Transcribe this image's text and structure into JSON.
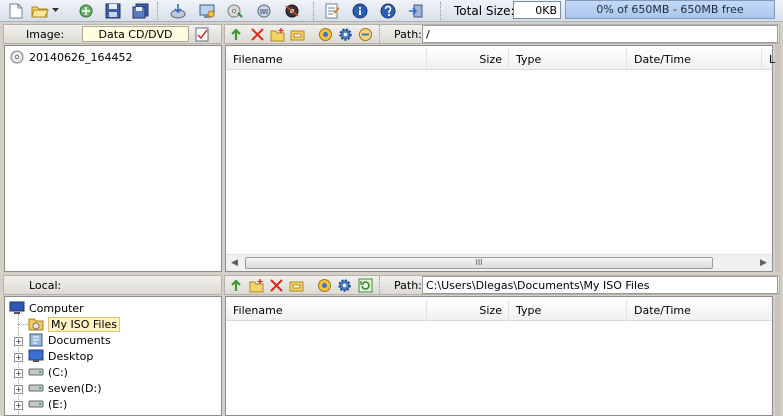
{
  "toolbar": {
    "buttons": [
      {
        "name": "new-icon"
      },
      {
        "name": "open-icon"
      },
      {
        "name": "open-dropdown-icon"
      },
      {
        "name": "recycle-icon"
      },
      {
        "name": "save-icon"
      },
      {
        "name": "save-as-icon"
      },
      {
        "name": "extract-icon"
      },
      {
        "name": "burn-icon"
      },
      {
        "name": "mount-icon"
      },
      {
        "name": "compress-icon"
      },
      {
        "name": "virtual-drive-icon"
      },
      {
        "name": "properties-icon"
      },
      {
        "name": "info-icon"
      },
      {
        "name": "help-icon"
      },
      {
        "name": "exit-icon"
      }
    ],
    "total_size_label": "Total Size:",
    "total_size_value": "0KB",
    "capacity_text": "0% of 650MB - 650MB free"
  },
  "image_panel": {
    "label": "Image:",
    "type_value": "Data CD/DVD",
    "tree_root": "20140626_164452"
  },
  "image_files": {
    "path_label": "Path:",
    "path_value": "/",
    "columns": [
      "Filename",
      "Size",
      "Type",
      "Date/Time",
      "L"
    ],
    "scroll_grip": "III"
  },
  "local_panel": {
    "label": "Local:",
    "tree": [
      {
        "label": "Computer",
        "icon": "computer-icon"
      },
      {
        "label": "My ISO Files",
        "icon": "folder-icon"
      },
      {
        "label": "Documents",
        "icon": "documents-icon"
      },
      {
        "label": "Desktop",
        "icon": "desktop-icon"
      },
      {
        "label": "(C:)",
        "icon": "drive-icon"
      },
      {
        "label": "seven(D:)",
        "icon": "drive-icon"
      },
      {
        "label": "(E:)",
        "icon": "drive-icon"
      }
    ]
  },
  "local_files": {
    "path_label": "Path:",
    "path_value": "C:\\Users\\Dlegas\\Documents\\My ISO Files",
    "columns": [
      "Filename",
      "Size",
      "Type",
      "Date/Time"
    ]
  }
}
